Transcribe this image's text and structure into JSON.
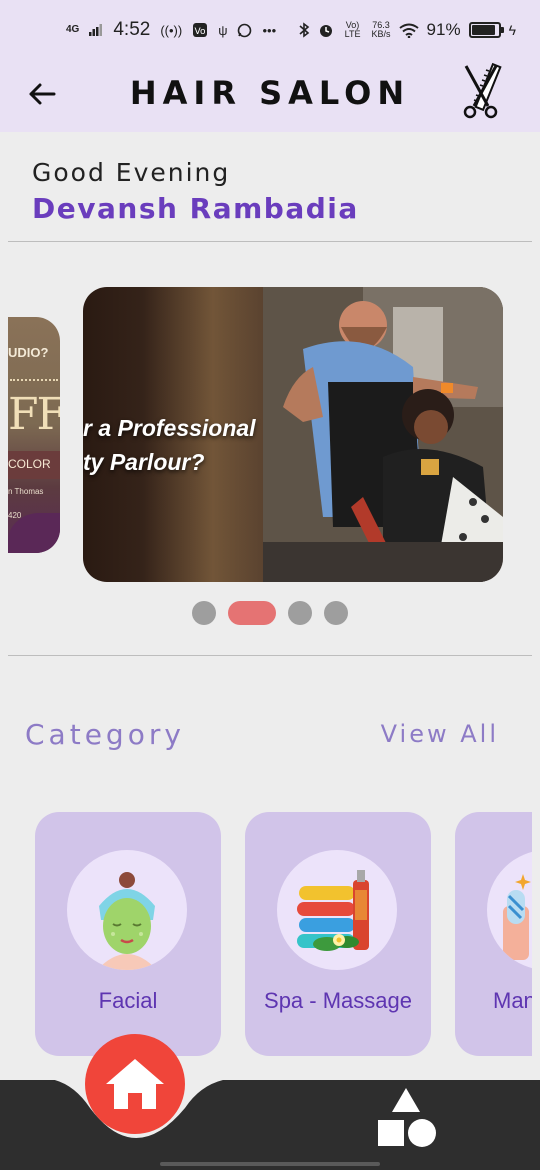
{
  "status_bar": {
    "network": "4G",
    "time": "4:52",
    "net_speed_value": "76.3",
    "net_speed_unit": "KB/s",
    "volte": "Vo) LTE",
    "battery_percent": "91%",
    "battery_level": 0.91
  },
  "header": {
    "title": "HAIR SALON",
    "back_icon": "arrow-left-icon",
    "logo_icon": "scissors-comb-icon"
  },
  "greeting": {
    "salutation": "Good Evening",
    "user_name": "Devansh Rambadia"
  },
  "banners": {
    "prev": {
      "text_top": "UDIO?",
      "text_big": "FF",
      "text_band": "COLOR",
      "text_small": "n Thomas",
      "text_small2": "420"
    },
    "current": {
      "line1": "r a Professional",
      "line2": "ty Parlour?"
    },
    "dot_count": 4,
    "active_index": 1
  },
  "category": {
    "title": "Category",
    "view_all": "View All",
    "items": [
      {
        "label": "Facial",
        "icon": "facial-mask-icon"
      },
      {
        "label": "Spa - Massage",
        "icon": "spa-towels-icon"
      },
      {
        "label": "Manicure",
        "icon": "nail-polish-icon"
      }
    ]
  },
  "bottom_nav": {
    "home_icon": "home-icon",
    "categories_icon": "shapes-icon"
  },
  "colors": {
    "app_bar_bg": "#e9e1f4",
    "accent_purple": "#6a3dbd",
    "category_card": "#d1c4e9",
    "home_fab": "#f0453a",
    "nav_bg": "#2e2e2e",
    "active_dot": "#e57373"
  }
}
